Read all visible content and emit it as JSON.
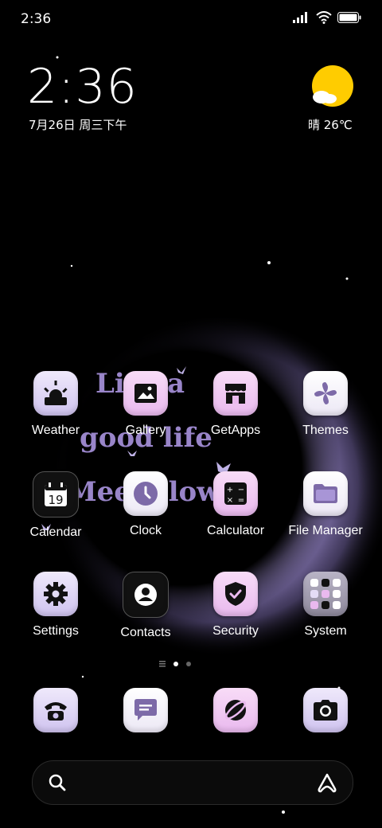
{
  "status_bar": {
    "time": "2:36",
    "icons": [
      "signal-icon",
      "wifi-icon",
      "battery-icon"
    ]
  },
  "clock_widget": {
    "time": "2:36",
    "date": "7月26日 周三下午"
  },
  "weather_widget": {
    "icon": "sun-cloud-icon",
    "text": "晴 26℃"
  },
  "wallpaper_text": {
    "line1": "Live a",
    "line2": "good life",
    "line3": "Meet slowly"
  },
  "apps": [
    {
      "label": "Weather",
      "icon": "weather-icon"
    },
    {
      "label": "Gallery",
      "icon": "gallery-icon"
    },
    {
      "label": "GetApps",
      "icon": "store-icon"
    },
    {
      "label": "Themes",
      "icon": "pinwheel-icon"
    },
    {
      "label": "Calendar",
      "icon": "calendar-icon",
      "day": "19"
    },
    {
      "label": "Clock",
      "icon": "clock-icon"
    },
    {
      "label": "Calculator",
      "icon": "calculator-icon"
    },
    {
      "label": "File Manager",
      "icon": "folder-icon"
    },
    {
      "label": "Settings",
      "icon": "gear-icon"
    },
    {
      "label": "Contacts",
      "icon": "contact-icon"
    },
    {
      "label": "Security",
      "icon": "shield-icon"
    },
    {
      "label": "System",
      "icon": "folder-grid-icon"
    }
  ],
  "dock": [
    {
      "icon": "phone-icon"
    },
    {
      "icon": "messages-icon"
    },
    {
      "icon": "browser-icon"
    },
    {
      "icon": "camera-icon"
    }
  ],
  "page_indicator": {
    "pages": 2,
    "current": 1
  },
  "colors": {
    "accent_purple": "#9985c9",
    "tile_pink": "#e9b9ee",
    "tile_lavender": "#cfc3ef",
    "sun_yellow": "#ffcc00"
  }
}
